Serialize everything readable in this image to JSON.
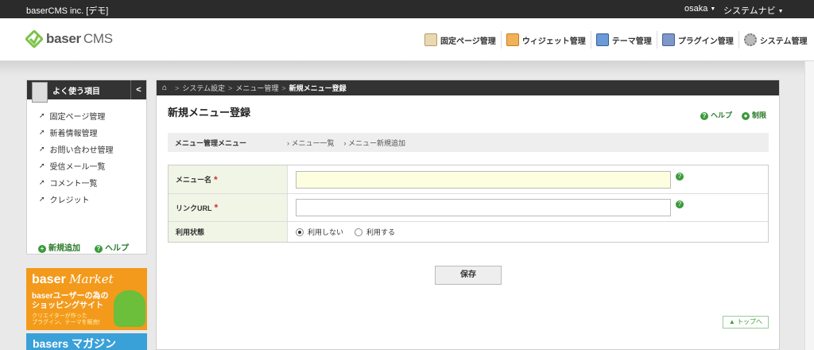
{
  "topbar": {
    "site_name": "baserCMS inc. [デモ]",
    "user": "osaka",
    "system_nav": "システムナビ"
  },
  "header": {
    "logo_text": "baser",
    "logo_suffix": "CMS",
    "nav": [
      {
        "label": "固定ページ管理",
        "icon": "page-icon",
        "color": "#c9a86a"
      },
      {
        "label": "ウィジェット管理",
        "icon": "widget-icon",
        "color": "#d98b2b"
      },
      {
        "label": "テーマ管理",
        "icon": "theme-icon",
        "color": "#3b6fb5"
      },
      {
        "label": "プラグイン管理",
        "icon": "plugin-icon",
        "color": "#5470a8"
      },
      {
        "label": "システム管理",
        "icon": "gear-icon",
        "color": "#888888"
      }
    ]
  },
  "sidebar": {
    "title": "よく使う項目",
    "collapse": "<",
    "items": [
      {
        "label": "固定ページ管理"
      },
      {
        "label": "新着情報管理"
      },
      {
        "label": "お問い合わせ管理"
      },
      {
        "label": "受信メール一覧"
      },
      {
        "label": "コメント一覧"
      },
      {
        "label": "クレジット"
      }
    ],
    "add_new": "新規追加",
    "help": "ヘルプ"
  },
  "banners": {
    "market_title": "baser",
    "market_title_script": "Market",
    "market_line1": "baserユーザーの為の",
    "market_line2": "ショッピングサイト",
    "market_small1": "クリエイターが作った",
    "market_small2": "プラグイン、テーマを販売!",
    "magazine": "basers マガジン"
  },
  "breadcrumb": {
    "home": "⌂",
    "items": [
      "システム設定",
      "メニュー管理"
    ],
    "current": "新規メニュー登録"
  },
  "page": {
    "title": "新規メニュー登録",
    "help": "ヘルプ",
    "restriction": "制限"
  },
  "submenu": {
    "title": "メニュー管理メニュー",
    "links": [
      "メニュー一覧",
      "メニュー新規追加"
    ]
  },
  "form": {
    "name_label": "メニュー名",
    "name_value": "",
    "url_label": "リンクURL",
    "url_value": "",
    "status_label": "利用状態",
    "status_options": [
      "利用しない",
      "利用する"
    ],
    "status_selected": "利用しない",
    "required_mark": "*",
    "help_mark": "?"
  },
  "buttons": {
    "save": "保存",
    "to_top": "▲ トップへ"
  }
}
